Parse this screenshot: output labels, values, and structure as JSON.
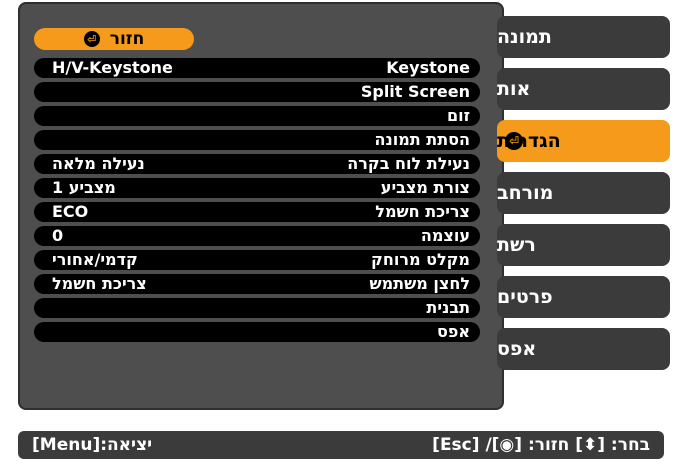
{
  "tabs": [
    {
      "label": "תמונה",
      "active": false
    },
    {
      "label": "אות",
      "active": false
    },
    {
      "label": "הגדרות",
      "active": true
    },
    {
      "label": "מורחב",
      "active": false
    },
    {
      "label": "רשת",
      "active": false
    },
    {
      "label": "פרטים",
      "active": false
    },
    {
      "label": "אפס",
      "active": false
    }
  ],
  "back_button": {
    "label": "חזור",
    "icon": "enter-icon"
  },
  "settings": [
    {
      "label": "Keystone",
      "value": "H/V-Keystone"
    },
    {
      "label": "Split Screen",
      "value": ""
    },
    {
      "label": "זום",
      "value": ""
    },
    {
      "label": "הסתת תמונה",
      "value": ""
    },
    {
      "label": "נעילת לוח בקרה",
      "value": "נעילה מלאה"
    },
    {
      "label": "צורת מצביע",
      "value": "מצביע 1"
    },
    {
      "label": "צריכת חשמל",
      "value": "ECO"
    },
    {
      "label": "עוצמה",
      "value": "0"
    },
    {
      "label": "מקלט מרוחק",
      "value": "קדמי/אחורי"
    },
    {
      "label": "לחצן משתמש",
      "value": "צריכת חשמל"
    },
    {
      "label": "תבנית",
      "value": ""
    },
    {
      "label": "אפס",
      "value": ""
    }
  ],
  "status_bar": {
    "exit_hint": "יציאה:[Menu]",
    "nav_hint": "בחר: [⬍] חזור: [◉]/ [Esc]"
  },
  "colors": {
    "accent": "#f59a1a",
    "panel": "#4e4e4e",
    "row": "#000000",
    "tab": "#3b3b3b"
  }
}
